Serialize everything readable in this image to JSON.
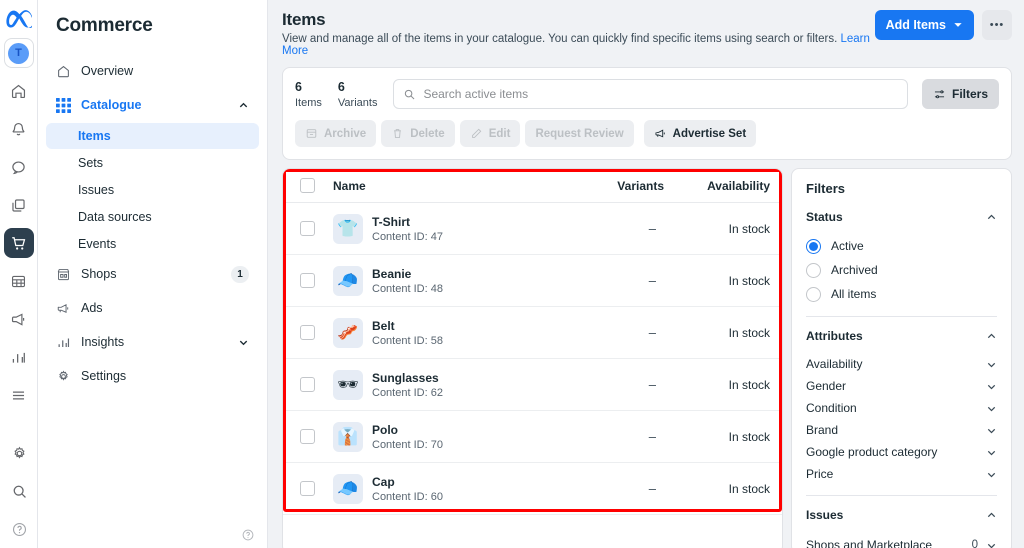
{
  "rail": {
    "logo": "meta-logo",
    "avatar_initial": "T",
    "icons": [
      "home-icon",
      "bell-icon",
      "messages-icon",
      "pages-icon",
      "commerce-cart-icon",
      "table-icon",
      "ads-megaphone-icon",
      "insights-bars-icon",
      "menu-icon"
    ],
    "bottom_icons": [
      "gear-icon",
      "search-icon",
      "help-icon"
    ]
  },
  "nav": {
    "title": "Commerce",
    "items": [
      {
        "label": "Overview",
        "icon": "home-icon",
        "badge": "",
        "chevron": ""
      },
      {
        "label": "Catalogue",
        "icon": "grid-icon",
        "badge": "",
        "chevron": "up"
      },
      {
        "label": "Shops",
        "icon": "shop-icon",
        "badge": "1",
        "chevron": ""
      },
      {
        "label": "Ads",
        "icon": "megaphone-icon",
        "badge": "",
        "chevron": ""
      },
      {
        "label": "Insights",
        "icon": "bars-icon",
        "badge": "",
        "chevron": "down"
      },
      {
        "label": "Settings",
        "icon": "gear-icon",
        "badge": "",
        "chevron": ""
      }
    ],
    "sub_items": [
      {
        "label": "Items",
        "selected": true
      },
      {
        "label": "Sets",
        "selected": false
      },
      {
        "label": "Issues",
        "selected": false
      },
      {
        "label": "Data sources",
        "selected": false
      },
      {
        "label": "Events",
        "selected": false
      }
    ],
    "help_icon": "help-icon"
  },
  "header": {
    "title": "Items",
    "subtitle": "View and manage all of the items in your catalogue. You can quickly find specific items using search or filters.",
    "learn_more": "Learn More",
    "add_items_label": "Add Items",
    "more_label": "•••"
  },
  "search_bar": {
    "items_count": "6",
    "items_label": "Items",
    "variants_count": "6",
    "variants_label": "Variants",
    "placeholder": "Search active items",
    "value": "",
    "filters_label": "Filters"
  },
  "toolbar": {
    "buttons": [
      {
        "label": "Archive",
        "icon": "archive-icon",
        "enabled": false
      },
      {
        "label": "Delete",
        "icon": "trash-icon",
        "enabled": false
      },
      {
        "label": "Edit",
        "icon": "pencil-icon",
        "enabled": false
      },
      {
        "label": "Request Review",
        "icon": "",
        "enabled": false
      },
      {
        "label": "Advertise Set",
        "icon": "megaphone-icon",
        "enabled": true
      }
    ]
  },
  "table": {
    "columns": {
      "name": "Name",
      "variants": "Variants",
      "availability": "Availability"
    },
    "rows": [
      {
        "name": "T-Shirt",
        "content_id": "Content ID: 47",
        "variants": "–",
        "availability": "In stock",
        "emoji": "👕"
      },
      {
        "name": "Beanie",
        "content_id": "Content ID: 48",
        "variants": "–",
        "availability": "In stock",
        "emoji": "🧢"
      },
      {
        "name": "Belt",
        "content_id": "Content ID: 58",
        "variants": "–",
        "availability": "In stock",
        "emoji": "🥓"
      },
      {
        "name": "Sunglasses",
        "content_id": "Content ID: 62",
        "variants": "–",
        "availability": "In stock",
        "emoji": "🕶"
      },
      {
        "name": "Polo",
        "content_id": "Content ID: 70",
        "variants": "–",
        "availability": "In stock",
        "emoji": "👔"
      },
      {
        "name": "Cap",
        "content_id": "Content ID: 60",
        "variants": "–",
        "availability": "In stock",
        "emoji": "🧢"
      }
    ]
  },
  "filters_panel": {
    "title": "Filters",
    "status": {
      "heading": "Status",
      "options": [
        {
          "label": "Active",
          "selected": true
        },
        {
          "label": "Archived",
          "selected": false
        },
        {
          "label": "All items",
          "selected": false
        }
      ]
    },
    "attributes": {
      "heading": "Attributes",
      "rows": [
        {
          "label": "Availability",
          "count": ""
        },
        {
          "label": "Gender",
          "count": ""
        },
        {
          "label": "Condition",
          "count": ""
        },
        {
          "label": "Brand",
          "count": ""
        },
        {
          "label": "Google product category",
          "count": ""
        },
        {
          "label": "Price",
          "count": ""
        }
      ]
    },
    "issues": {
      "heading": "Issues",
      "rows": [
        {
          "label": "Shops and Marketplace",
          "count": "0"
        }
      ]
    }
  },
  "colors": {
    "accent": "#1877f2",
    "highlight_box": "#ff0000",
    "rail_active": "#2d3f4e",
    "page_bg": "#f0f2f5"
  }
}
